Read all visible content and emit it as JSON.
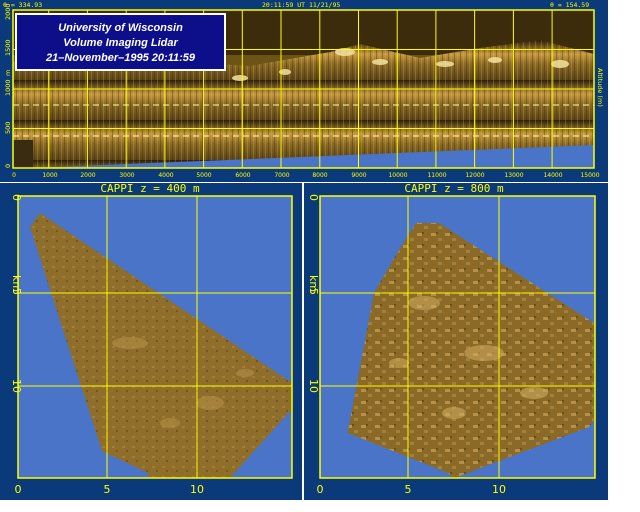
{
  "header": {
    "left_readout": "θ = 334.93",
    "center_readout": "20:11:59 UT 11/21/95",
    "right_readout": "θ = 154.59"
  },
  "title_box": {
    "line1": "University of Wisconsin",
    "line2": "Volume Imaging Lidar",
    "line3": "21–November–1995 20:11:59"
  },
  "rhi": {
    "x_ticks": [
      "0",
      "1000",
      "2000",
      "3000",
      "4000",
      "5000",
      "6000",
      "7000",
      "8000",
      "9000",
      "10000",
      "11000",
      "12000",
      "13000",
      "14000",
      "15000"
    ],
    "y_ticks": [
      "0",
      "500",
      "1000",
      "1500",
      "2000"
    ],
    "y_unit": "m",
    "right_label": "Altitude (m)",
    "colors": {
      "frame": "#ffff00",
      "sky": "#4a74c8",
      "aerosol": "#8a6a20",
      "dashed": "#ffff99"
    }
  },
  "cappi_left": {
    "title": "CAPPI   z = 400 m",
    "x_ticks": [
      "0",
      "5",
      "10"
    ],
    "y_ticks": [
      "0",
      "5",
      "10"
    ],
    "y_unit": "km"
  },
  "cappi_right": {
    "title": "CAPPI   z = 800 m",
    "x_ticks": [
      "0",
      "5",
      "10"
    ],
    "y_ticks": [
      "0",
      "5",
      "10"
    ],
    "y_unit": "km"
  }
}
